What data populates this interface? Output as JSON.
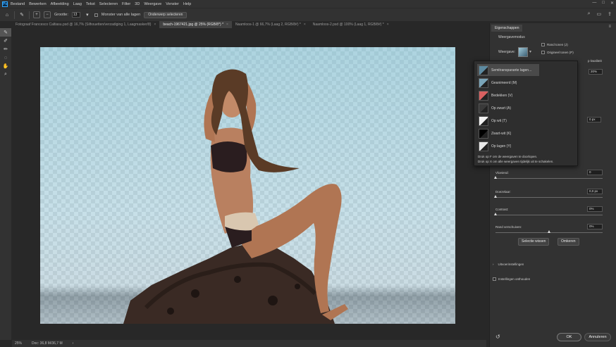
{
  "app": {
    "logo": "Ps"
  },
  "menu": [
    "Bestand",
    "Bewerken",
    "Afbeelding",
    "Laag",
    "Tekst",
    "Selecteren",
    "Filter",
    "3D",
    "Weergave",
    "Venster",
    "Help"
  ],
  "window_controls": [
    "—",
    "□",
    "✕"
  ],
  "options": {
    "size_label": "Grootte:",
    "size_value": "13",
    "sample_all_label": "Monster van alle lagen",
    "select_subject_label": "Onderwerp selecteren"
  },
  "tabs": [
    {
      "label": "Fotograaf Francesco Caltiasu.psd @ 16,7% (Silhouetten/verzadiging 1, Laagmasker/8)",
      "active": false
    },
    {
      "label": "beach-1967421.jpg @ 25% (RGB/8*) *",
      "active": true
    },
    {
      "label": "Naamloos-1 @ 66,7% (Laag 2, RGB/8#) *",
      "active": false
    },
    {
      "label": "Naamloos-2.psd @ 100% (Laag 1, RGB/8#) *",
      "active": false
    }
  ],
  "status": {
    "zoom": "25%",
    "doc": "Doc: 36,8 M/36,7 M"
  },
  "panel": {
    "tab": "Eigenschappen",
    "section": "Weergavemodus",
    "view_label": "Weergave:",
    "show_edge": "Rand tonen (J)",
    "show_original": "Origineel tonen (P)",
    "partial_label": "p kwaliteit",
    "opacity_value": "20%",
    "radius_value": "0 px",
    "sliders": [
      {
        "label": "Vloeiend:",
        "value": "0",
        "level": 0.0
      },
      {
        "label": "Doezelaar:",
        "value": "0,0 px",
        "level": 0.0
      },
      {
        "label": "Contrast:",
        "value": "0%",
        "level": 0.0
      },
      {
        "label": "Rand verschuiven:",
        "value": "0%",
        "level": 0.5
      }
    ],
    "clear_selection": "Selectie wissen",
    "invert": "Omkeren",
    "output_settings": "Uitvoerinstellingen",
    "remember_settings": "Instellingen onthouden",
    "ok": "OK",
    "cancel": "Annuleren"
  },
  "dropdown": {
    "items": [
      {
        "label": "Semitransparante lagen...",
        "selected": true,
        "thumb": "#5d8aa0"
      },
      {
        "label": "Geanimeerd (M)",
        "selected": false,
        "thumb": "#7aa4b8"
      },
      {
        "label": "Bedekken (V)",
        "selected": false,
        "thumb": "#d86060"
      },
      {
        "label": "Op zwart (A)",
        "selected": false,
        "thumb": "#3a3a3a"
      },
      {
        "label": "Op wit (T)",
        "selected": false,
        "thumb": "#f2f2f2"
      },
      {
        "label": "Zwart-wit (K)",
        "selected": false,
        "thumb": "#000000"
      },
      {
        "label": "Op lagen (Y)",
        "selected": false,
        "thumb": "#e8e8e8"
      }
    ],
    "hint1": "Druk op F om de weergaven te doorlopen.",
    "hint2": "Druk op X om alle weergaven tijdelijk uit te schakelen."
  }
}
